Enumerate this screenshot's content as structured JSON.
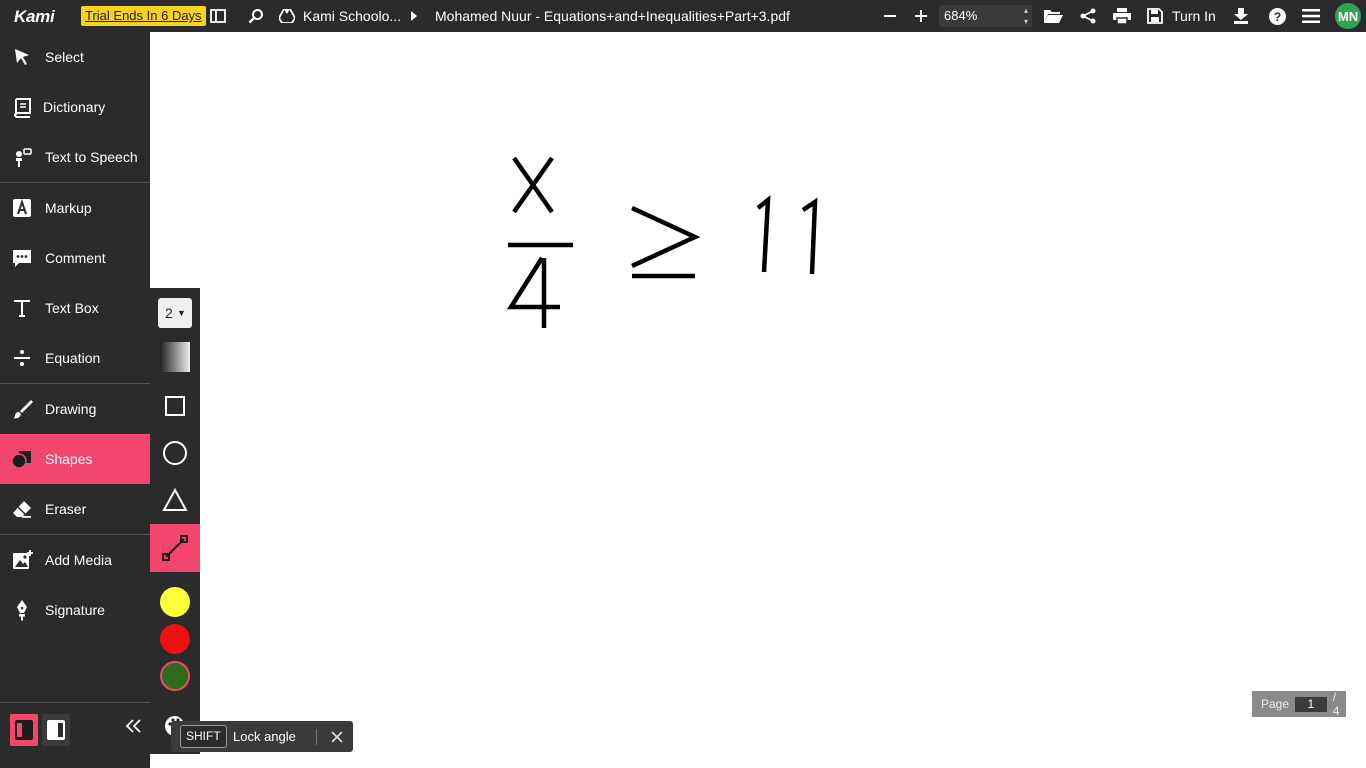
{
  "topbar": {
    "logo": "Kami",
    "trial_label": "Trial Ends In 6 Days",
    "breadcrumb_folder": "Kami Schoolo...",
    "file_name": "Mohamed Nuur - Equations+and+Inequalities+Part+3.pdf",
    "zoom_value": "684%",
    "turn_in_label": "Turn In",
    "avatar_initials": "MN",
    "avatar_color": "#2ea44f"
  },
  "sidebar": {
    "items": [
      {
        "label": "Select",
        "icon": "cursor-arrow-icon"
      },
      {
        "label": "Dictionary",
        "icon": "book-icon"
      },
      {
        "label": "Text to Speech",
        "icon": "speaker-person-icon"
      },
      {
        "label": "Markup",
        "icon": "markup-highlight-icon"
      },
      {
        "label": "Comment",
        "icon": "comment-bubble-icon"
      },
      {
        "label": "Text Box",
        "icon": "text-t-icon"
      },
      {
        "label": "Equation",
        "icon": "division-icon"
      },
      {
        "label": "Drawing",
        "icon": "brush-icon"
      },
      {
        "label": "Shapes",
        "icon": "shapes-icon"
      },
      {
        "label": "Eraser",
        "icon": "eraser-icon"
      },
      {
        "label": "Add Media",
        "icon": "add-image-icon"
      },
      {
        "label": "Signature",
        "icon": "pen-nib-icon"
      }
    ],
    "active_item": "Shapes",
    "accent_color": "#f3466f"
  },
  "shapes_toolbar": {
    "stroke_size": "2",
    "shapes": [
      "rectangle-icon",
      "circle-icon",
      "triangle-icon",
      "line-icon"
    ],
    "active_shape": "line-icon",
    "colors": [
      "#ffff3b",
      "#ee1111",
      "#2e6b1a"
    ],
    "selected_color": "#2e6b1a"
  },
  "page_indicator": {
    "label": "Page",
    "current": "1",
    "total": "/ 4"
  },
  "tooltip": {
    "key": "SHIFT",
    "text": "Lock angle"
  },
  "document": {
    "expression": "x/4 ≥ 11"
  }
}
